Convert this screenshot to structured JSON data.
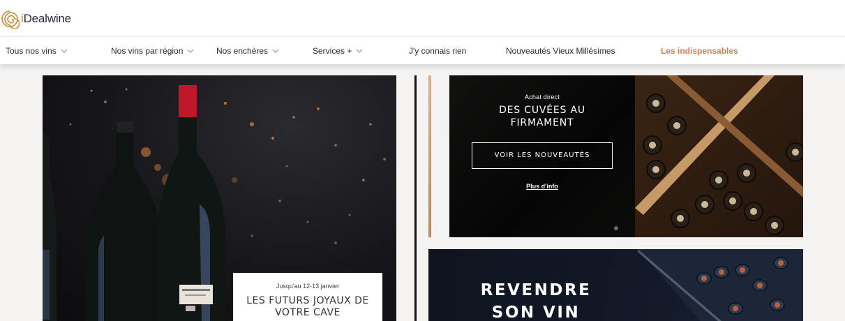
{
  "header": {
    "logo_text_prefix": "i",
    "logo_text_main": "Dealwine"
  },
  "nav": {
    "items": [
      {
        "label": "Tous nos vins",
        "has_dropdown": true
      },
      {
        "label": "Nos vins par région",
        "has_dropdown": true
      },
      {
        "label": "Nos enchères",
        "has_dropdown": true
      },
      {
        "label": "Services +",
        "has_dropdown": true
      },
      {
        "label": "J'y connais rien",
        "has_dropdown": false
      },
      {
        "label": "Nouveautés Vieux Millésimes",
        "has_dropdown": false
      },
      {
        "label": "Les indispensables",
        "has_dropdown": false
      }
    ]
  },
  "hero_left": {
    "promo_date": "Jusqu'au 12-13 janvier",
    "promo_title": "LES FUTURS JOYAUX DE VOTRE CAVE"
  },
  "banner_top": {
    "kicker": "Achat direct",
    "title": "DES CUVÉES AU FIRMAMENT",
    "button_label": "VOIR LES NOUVEAUTÉS",
    "link_label": "Plus d'info"
  },
  "banner_bottom": {
    "title": "REVENDRE SON VIN"
  },
  "colors": {
    "accent": "#c7825e",
    "logo_gold": "#c48a3c",
    "page_bg": "#f4f3f1"
  }
}
